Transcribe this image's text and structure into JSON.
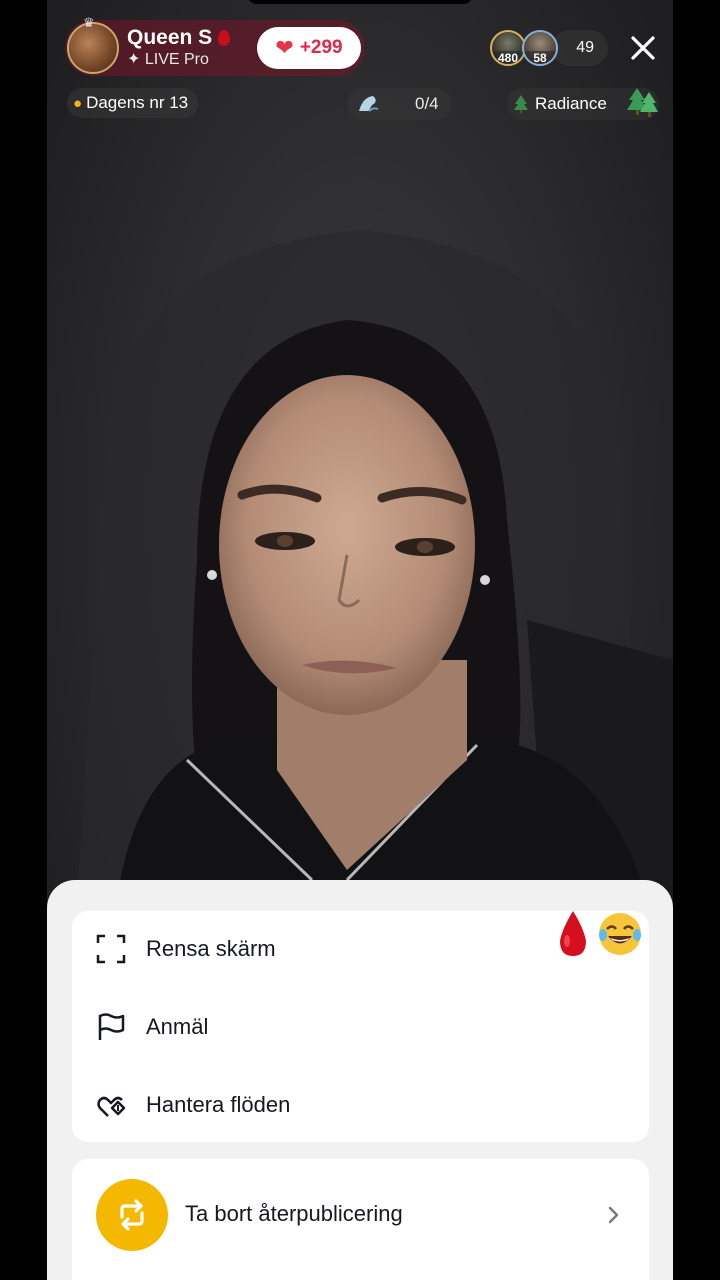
{
  "host": {
    "name": "Queen S",
    "subtitle": "LIVE Pro",
    "follow_count": "+299"
  },
  "viewers": {
    "avatar1_badge": "480",
    "avatar2_badge": "58",
    "count": "49"
  },
  "second_row": {
    "ranking_label": "Dagens nr 13",
    "goal_progress": "0/4",
    "radiance_label": "Radiance"
  },
  "sheet": {
    "menu_items": [
      {
        "label": "Rensa skärm",
        "icon": "clear-screen-icon"
      },
      {
        "label": "Anmäl",
        "icon": "flag-icon"
      },
      {
        "label": "Hantera flöden",
        "icon": "manage-feed-icon"
      }
    ],
    "repost_label": "Ta bort återpublicering"
  },
  "colors": {
    "accent_red": "#e02848",
    "repost_yellow": "#f5b800",
    "sheet_bg": "#f1f1f2"
  }
}
